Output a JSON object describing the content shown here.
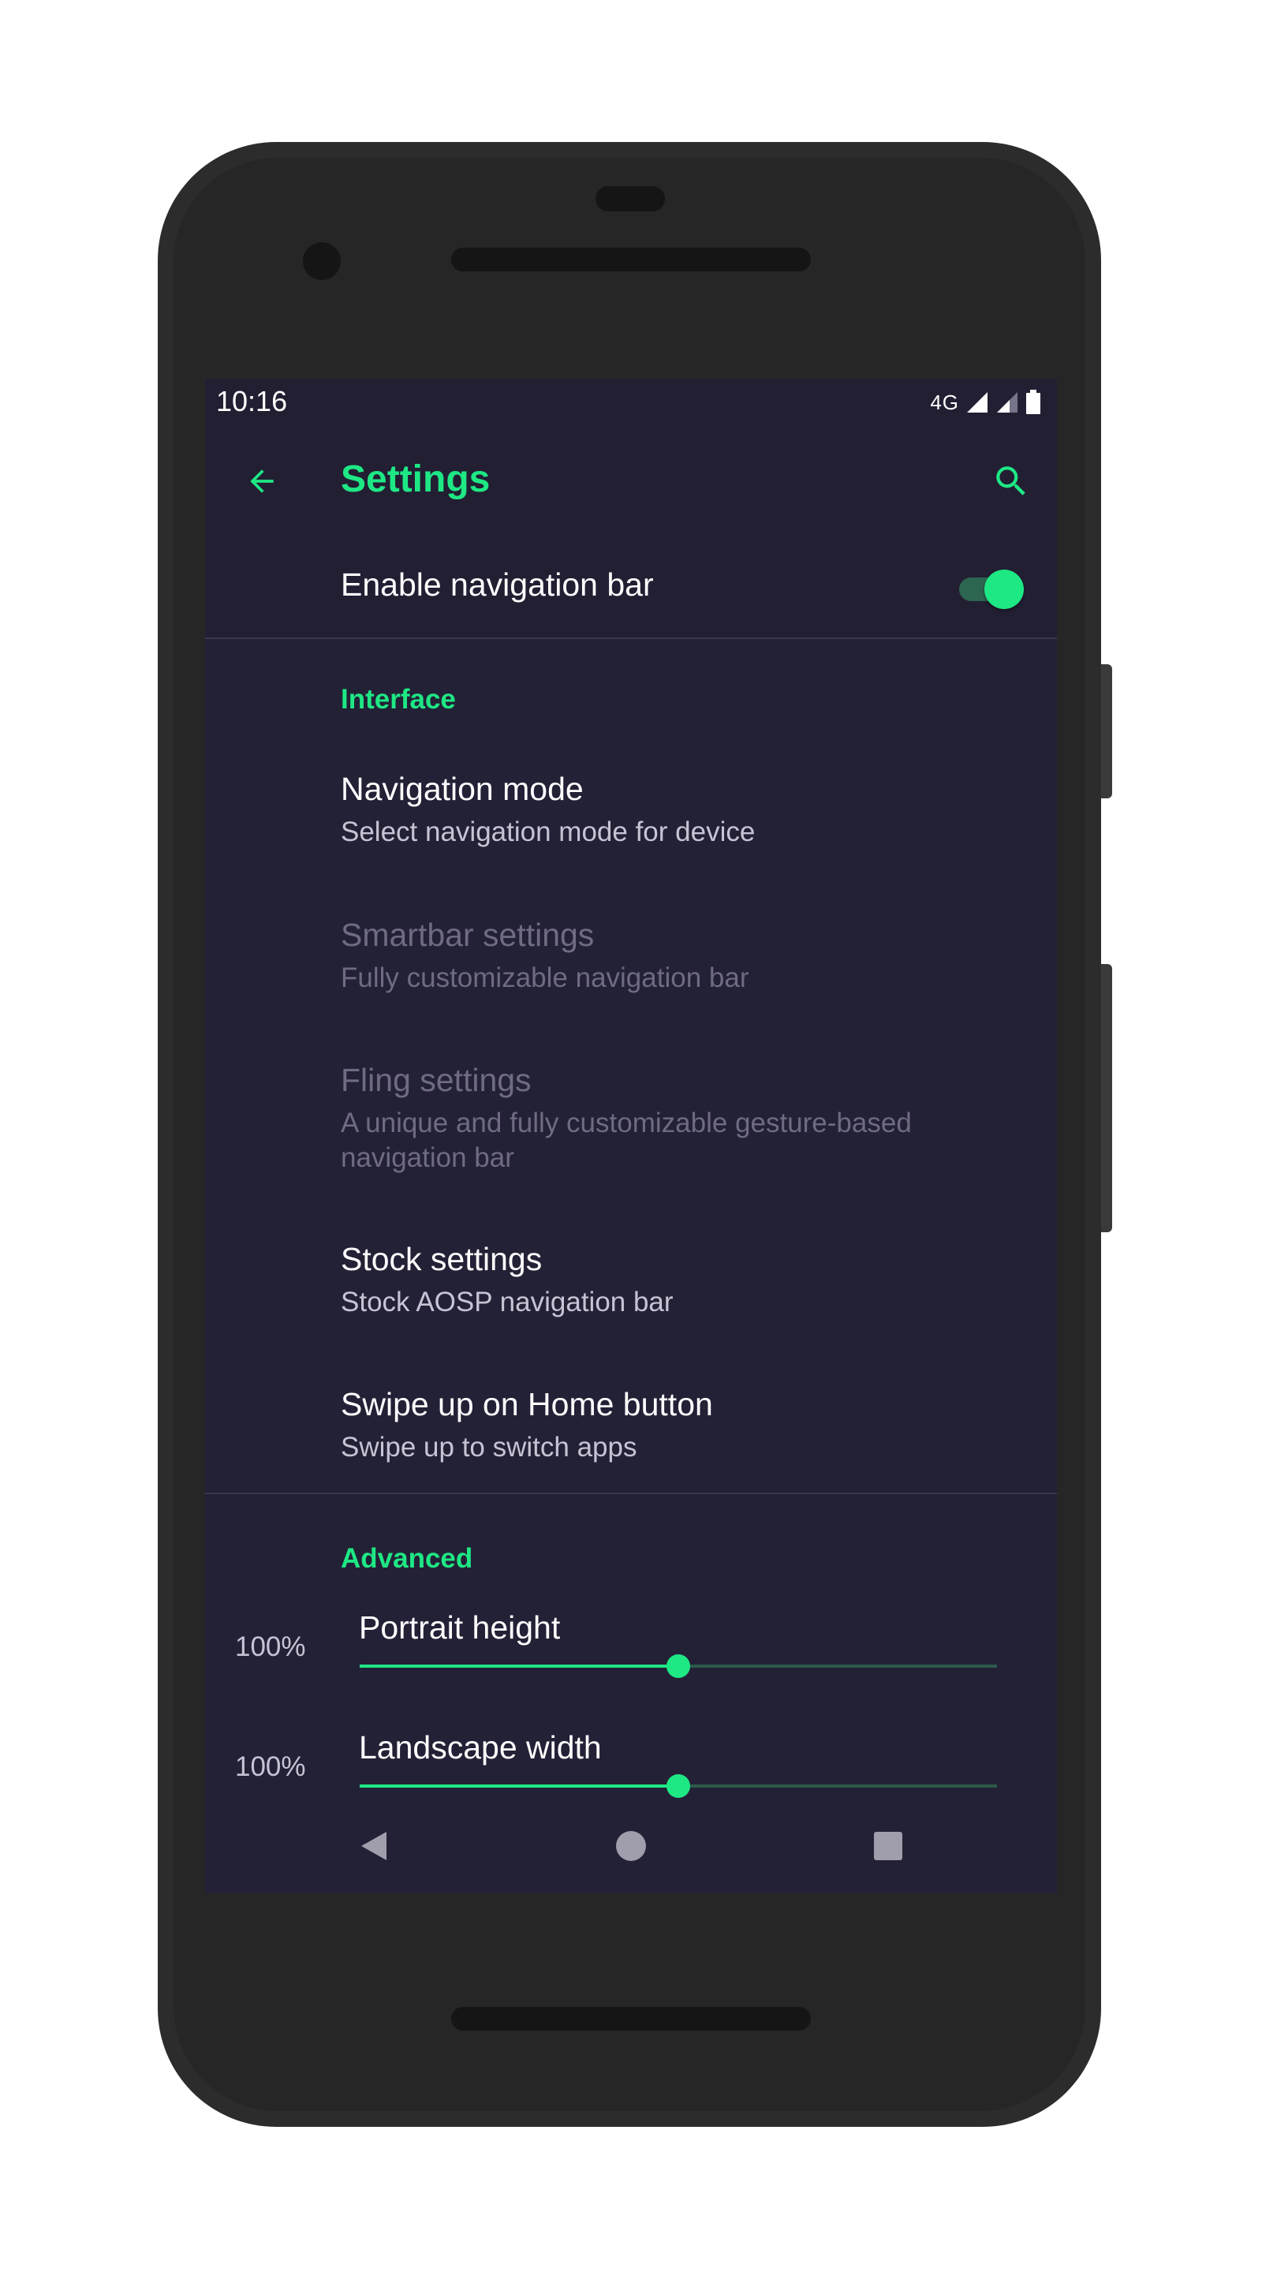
{
  "status_bar": {
    "time": "10:16",
    "network": "4G"
  },
  "app_bar": {
    "title": "Settings",
    "back_icon": "arrow-back-icon",
    "search_icon": "search-icon"
  },
  "master_switch": {
    "label": "Enable navigation bar",
    "checked": true
  },
  "sections": {
    "interface": {
      "header": "Interface",
      "items": [
        {
          "title": "Navigation mode",
          "summary": "Select navigation mode for device",
          "enabled": true
        },
        {
          "title": "Smartbar settings",
          "summary": "Fully customizable navigation bar",
          "enabled": false
        },
        {
          "title": "Fling settings",
          "summary": "A unique and fully customizable gesture-based navigation bar",
          "enabled": false
        },
        {
          "title": "Stock settings",
          "summary": "Stock AOSP navigation bar",
          "enabled": true
        },
        {
          "title": "Swipe up on Home button",
          "summary": "Swipe up to switch apps",
          "enabled": true
        }
      ]
    },
    "advanced": {
      "header": "Advanced",
      "sliders": [
        {
          "title": "Portrait height",
          "value_label": "100%",
          "fraction": 0.5
        },
        {
          "title": "Landscape width",
          "value_label": "100%",
          "fraction": 0.5
        }
      ]
    }
  },
  "nav_bar": {
    "back_icon": "triangle-back-icon",
    "home_icon": "circle-home-icon",
    "recents_icon": "square-recents-icon"
  },
  "colors": {
    "accent": "#1ee884",
    "background": "#232136",
    "bar_background": "#221f33",
    "text_primary": "#ffffff",
    "text_secondary": "#c6c4d3",
    "text_disabled": "#6e6b82",
    "phone_frame": "#2c2c2c"
  }
}
